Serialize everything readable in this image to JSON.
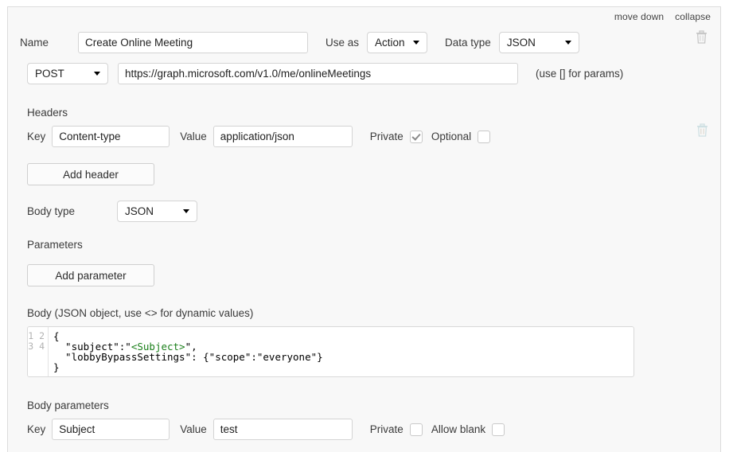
{
  "panel": {
    "actions": [
      {
        "label": "move down",
        "name": "move-down-link"
      },
      {
        "label": "collapse",
        "name": "collapse-link"
      }
    ],
    "delete_tooltip": "delete"
  },
  "name_row": {
    "name_label": "Name",
    "name_value": "Create Online Meeting",
    "name_placeholder": "",
    "use_as_label": "Use as",
    "use_as_value": "Action",
    "data_type_label": "Data type",
    "data_type_value": "JSON"
  },
  "request_row": {
    "method_value": "POST",
    "url_value": "https://graph.microsoft.com/v1.0/me/onlineMeetings",
    "url_placeholder": "",
    "hint": "(use [] for params)"
  },
  "headers": {
    "title": "Headers",
    "key_label": "Key",
    "key_value": "Content-type",
    "value_label": "Value",
    "value_value": "application/json",
    "private_label": "Private",
    "private_checked": true,
    "optional_label": "Optional",
    "optional_checked": false,
    "add_button": "Add header"
  },
  "body_type": {
    "label": "Body type",
    "value": "JSON"
  },
  "parameters": {
    "title": "Parameters",
    "add_button": "Add parameter"
  },
  "body": {
    "title": "Body (JSON object, use <> for dynamic values)",
    "line_numbers": "1\n2\n3\n4",
    "code_line_1": "{",
    "code_line_2_pre": "  \"subject\":\"",
    "code_line_2_dyn": "<Subject>",
    "code_line_2_post": "\",",
    "code_line_3": "  \"lobbyBypassSettings\": {\"scope\":\"everyone\"}",
    "code_line_4": "}"
  },
  "body_parameters": {
    "title": "Body parameters",
    "key_label": "Key",
    "key_value": "Subject",
    "value_label": "Value",
    "value_value": "test",
    "private_label": "Private",
    "private_checked": false,
    "allow_blank_label": "Allow blank",
    "allow_blank_checked": false
  },
  "colors": {
    "panel_bg": "#f8f8f8",
    "border": "#dcdcdc",
    "text": "#3b3b3b",
    "dynamic_token": "#1a7f1a"
  }
}
